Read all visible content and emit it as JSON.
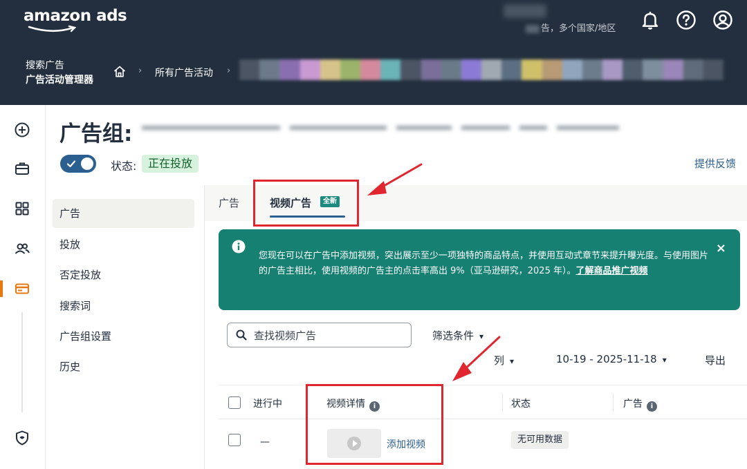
{
  "header": {
    "logo": "amazon ads",
    "account_region": "告，多个国家/地区",
    "product_line1": "搜索广告",
    "product_line2": "广告活动管理器",
    "breadcrumb_all": "所有广告活动",
    "breadcrumb_sep": "›",
    "icons": [
      "bell-icon",
      "help-icon",
      "user-icon",
      "home-icon"
    ]
  },
  "rail": {
    "icons": [
      "add-icon",
      "briefcase-icon",
      "grid-icon",
      "people-icon",
      "card-icon",
      "shield-icon"
    ],
    "accent_color": "#e47911"
  },
  "page": {
    "title": "广告组:",
    "status_label": "状态:",
    "status_value": "正在投放",
    "feedback": "提供反馈"
  },
  "subnav": {
    "items": [
      {
        "label": "广告",
        "active": true
      },
      {
        "label": "投放",
        "active": false
      },
      {
        "label": "否定投放",
        "active": false
      },
      {
        "label": "搜索词",
        "active": false
      },
      {
        "label": "广告组设置",
        "active": false
      },
      {
        "label": "历史",
        "active": false
      }
    ]
  },
  "tabs": {
    "ads": "广告",
    "video": "视频广告",
    "new_badge": "全新"
  },
  "banner": {
    "text": "您现在可以在广告中添加视频，突出展示至少一项独特的商品特点，并使用互动式章节来提升曝光度。与使用图片的广告主相比，使用视频的广告主的点击率高出 9%（亚马逊研究，2025 年）。",
    "link": "了解商品推广视频",
    "close": "×",
    "color": "#168073"
  },
  "toolbar": {
    "search_placeholder": "查找视频广告",
    "filter": "筛选条件",
    "columns": "列",
    "date_range": "10-19 - 2025-11-18",
    "export": "导出"
  },
  "table": {
    "headers": {
      "in_progress": "进行中",
      "video_details": "视频详情",
      "status": "状态",
      "ad": "广告"
    },
    "rows": [
      {
        "in_progress": "—",
        "video_action": "添加视频",
        "status": "无可用数据"
      }
    ]
  },
  "annotation_color": "#e0262e"
}
